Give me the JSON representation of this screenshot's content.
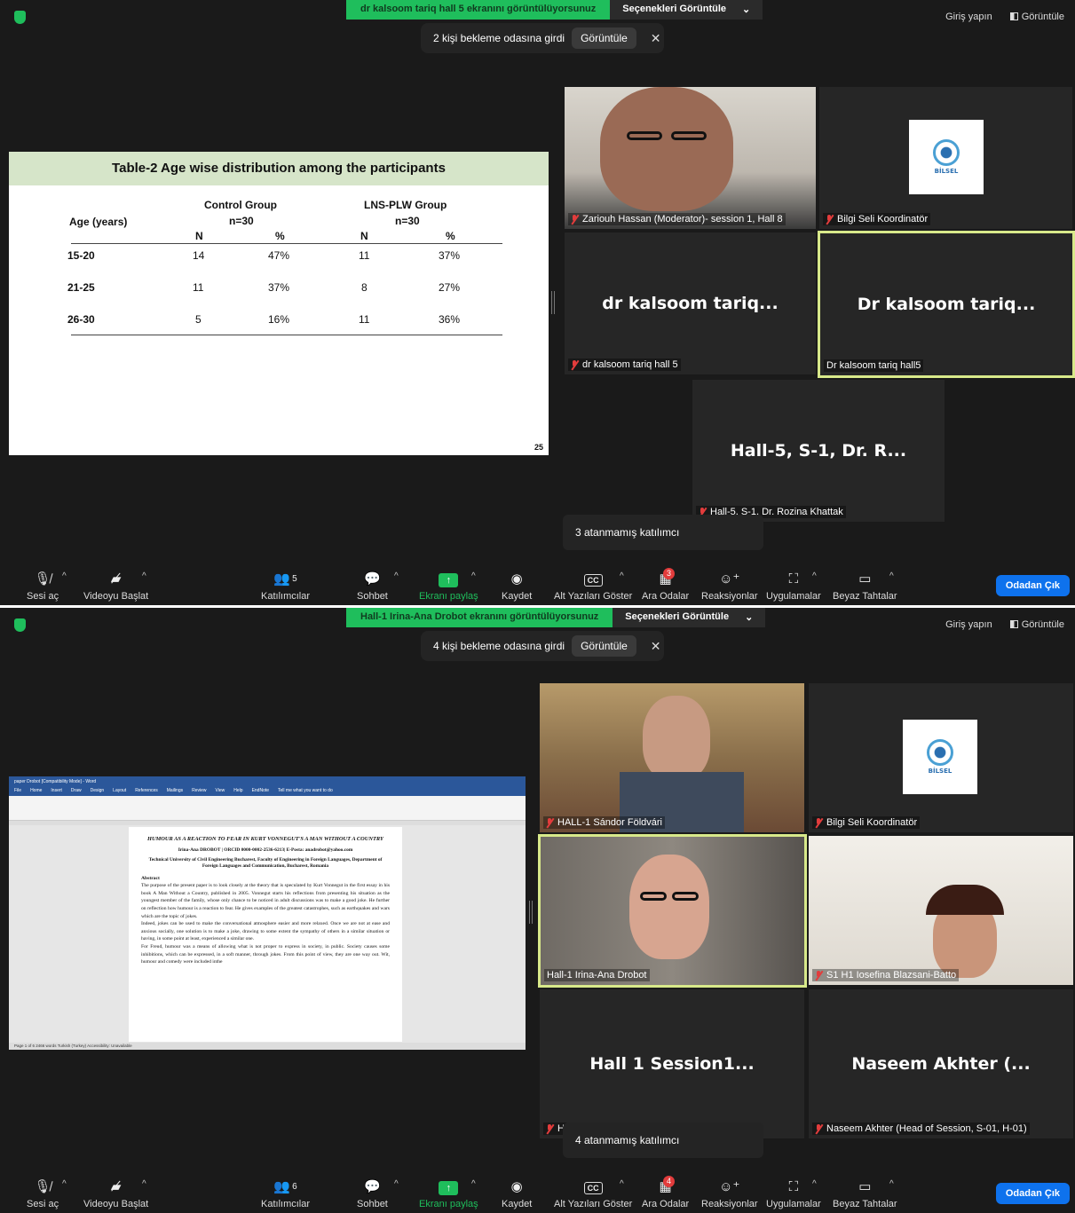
{
  "screens": [
    {
      "share_banner": "dr kalsoom tariq hall  5 ekranını görüntülüyorsunuz",
      "view_options": "Seçenekleri Görüntüle",
      "toast_text": "2 kişi bekleme odasına girdi",
      "toast_button": "Görüntüle",
      "signin": "Giriş yapın",
      "view": "Görüntüle",
      "unassigned": "3 atanmamış katılımcı",
      "participants_count": "5",
      "breakout_badge": "3",
      "slide": {
        "title": "Table-2  Age wise distribution among the participants",
        "col_age": "Age  (years)",
        "group1": "Control Group",
        "group1_n": "n=30",
        "group2": "LNS-PLW Group",
        "group2_n": "n=30",
        "h_n1": "N",
        "h_p1": "%",
        "h_n2": "N",
        "h_p2": "%",
        "rows": [
          {
            "age": "15-20",
            "n1": "14",
            "p1": "47%",
            "n2": "11",
            "p2": "37%"
          },
          {
            "age": "21-25",
            "n1": "11",
            "p1": "37%",
            "n2": "8",
            "p2": "27%"
          },
          {
            "age": "26-30",
            "n1": "5",
            "p1": "16%",
            "n2": "11",
            "p2": "36%"
          }
        ],
        "page": "25"
      },
      "tiles": [
        {
          "label": "Zariouh Hassan (Moderator)- session 1, Hall 8"
        },
        {
          "label": "Bilgi Seli Koordinatör",
          "logo": "BİLSEL"
        },
        {
          "big": "dr kalsoom tariq...",
          "label": "dr kalsoom tariq hall  5"
        },
        {
          "big": "Dr kalsoom tariq...",
          "label": "Dr kalsoom tariq hall5"
        },
        {
          "big": "Hall-5, S-1, Dr. R...",
          "label": "Hall-5, S-1, Dr. Rozina Khattak"
        }
      ]
    },
    {
      "share_banner": "Hall-1 Irina-Ana Drobot ekranını görüntülüyorsunuz",
      "view_options": "Seçenekleri Görüntüle",
      "toast_text": "4 kişi bekleme odasına girdi",
      "toast_button": "Görüntüle",
      "signin": "Giriş yapın",
      "view": "Görüntüle",
      "unassigned": "4 atanmamış katılımcı",
      "participants_count": "6",
      "breakout_badge": "4",
      "doc": {
        "window_title": "paper Drobot [Compatibility Mode] - Word",
        "tabs": [
          "File",
          "Home",
          "Insert",
          "Draw",
          "Design",
          "Layout",
          "References",
          "Mailings",
          "Review",
          "View",
          "Help",
          "EndNote",
          "Tell me what you want to do"
        ],
        "title": "HUMOUR AS A REACTION TO FEAR IN KURT VONNEGUT'S A MAN WITHOUT A COUNTRY",
        "author": "Irina-Ana DROBOT | ORCID 0000-0002-2536-6213| E-Posta: anadrobot@yahoo.com",
        "affil": "Technical University of Civil Engineering Bucharest, Faculty of Engineering in Foreign Languages, Department of Foreign Languages and Communication, Bucharest, Romania",
        "abstract_label": "Abstract",
        "p1": "The purpose of the present paper is to look closely at the theory that is speculated by Kurt Vonnegut in the first essay in his book A Man Without a Country, published in 2005. Vonnegut starts his reflections from presenting his situation as the youngest member of the family, whose only chance to be noticed in adult discussions was to make a good joke. He further on reflection how humour is a reaction to fear. He gives examples of the greatest catastrophes, such as earthquakes and wars which are the topic of jokes.",
        "p2": "Indeed, jokes can be used to make the conversational atmosphere easier and more relaxed. Once we are not at ease and anxious socially, one solution is to make a joke, drawing to some extent the sympathy of others in a similar situation or having, in some point at least, experienced a similar one.",
        "p3": "For Freud, humour was a means of allowing what is not proper to express in society, in public. Society causes some inhibitions, which can be expressed, in a soft manner, through jokes. From this point of view, they are one way out. Wit, humour and comedy were included inthe",
        "status": "Page 1 of 6    2466 words    Turkish (Turkey)    Accessibility: Unavailable"
      },
      "tiles": [
        {
          "label": "HALL-1 Sándor Földvári"
        },
        {
          "label": "Bilgi Seli Koordinatör",
          "logo": "BİLSEL"
        },
        {
          "label": "Hall-1 Irina-Ana Drobot"
        },
        {
          "label": "S1 H1 Iosefina Blazsani-Batto"
        },
        {
          "big": "Hall 1 Session1...",
          "label": "H"
        },
        {
          "big": "Naseem Akhter (...",
          "label": "Naseem Akhter (Head of Session, S-01, H-01)"
        }
      ]
    }
  ],
  "toolbar": {
    "unmute": "Sesi aç",
    "start_video": "Videoyu Başlat",
    "participants": "Katılımcılar",
    "chat": "Sohbet",
    "share": "Ekranı paylaş",
    "record": "Kaydet",
    "captions": "Alt Yazıları Göster",
    "breakout": "Ara Odalar",
    "reactions": "Reaksiyonlar",
    "apps": "Uygulamalar",
    "whiteboard": "Beyaz Tahtalar",
    "leave": "Odadan Çık"
  },
  "colors": {
    "background": "#1a1a1a",
    "share_green": "#1fbe5c",
    "active_speaker": "#d8e98a",
    "leave_blue": "#0e72ed",
    "mute_red": "#e23c3c"
  },
  "icons": [
    "shield-icon",
    "mic-muted-icon",
    "video-off-icon",
    "participants-icon",
    "chat-icon",
    "share-screen-icon",
    "record-icon",
    "cc-icon",
    "breakout-rooms-icon",
    "reactions-icon",
    "apps-icon",
    "whiteboard-icon",
    "close-icon",
    "view-layout-icon"
  ]
}
